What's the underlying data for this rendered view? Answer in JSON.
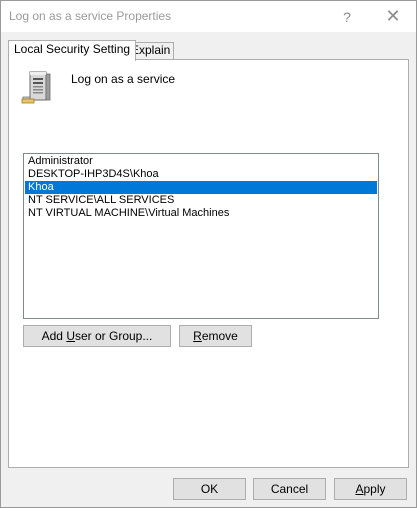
{
  "window": {
    "title": "Log on as a service Properties",
    "help_glyph": "?",
    "close_glyph": "✕"
  },
  "tabs": [
    {
      "label": "Local Security Setting",
      "active": true
    },
    {
      "label": "Explain",
      "active": false
    }
  ],
  "policy": {
    "icon": "server-computer-icon",
    "name": "Log on as a service"
  },
  "accounts": {
    "items": [
      {
        "label": "Administrator",
        "selected": false
      },
      {
        "label": "DESKTOP-IHP3D4S\\Khoa",
        "selected": false
      },
      {
        "label": "Khoa",
        "selected": true
      },
      {
        "label": "NT SERVICE\\ALL SERVICES",
        "selected": false
      },
      {
        "label": "NT VIRTUAL MACHINE\\Virtual Machines",
        "selected": false
      }
    ],
    "selection_color": "#0078d7"
  },
  "buttons": {
    "add_pre": "Add ",
    "add_accel": "U",
    "add_post": "ser or Group...",
    "remove_accel": "R",
    "remove_post": "emove",
    "ok": "OK",
    "cancel": "Cancel",
    "apply_accel": "A",
    "apply_post": "pply"
  }
}
